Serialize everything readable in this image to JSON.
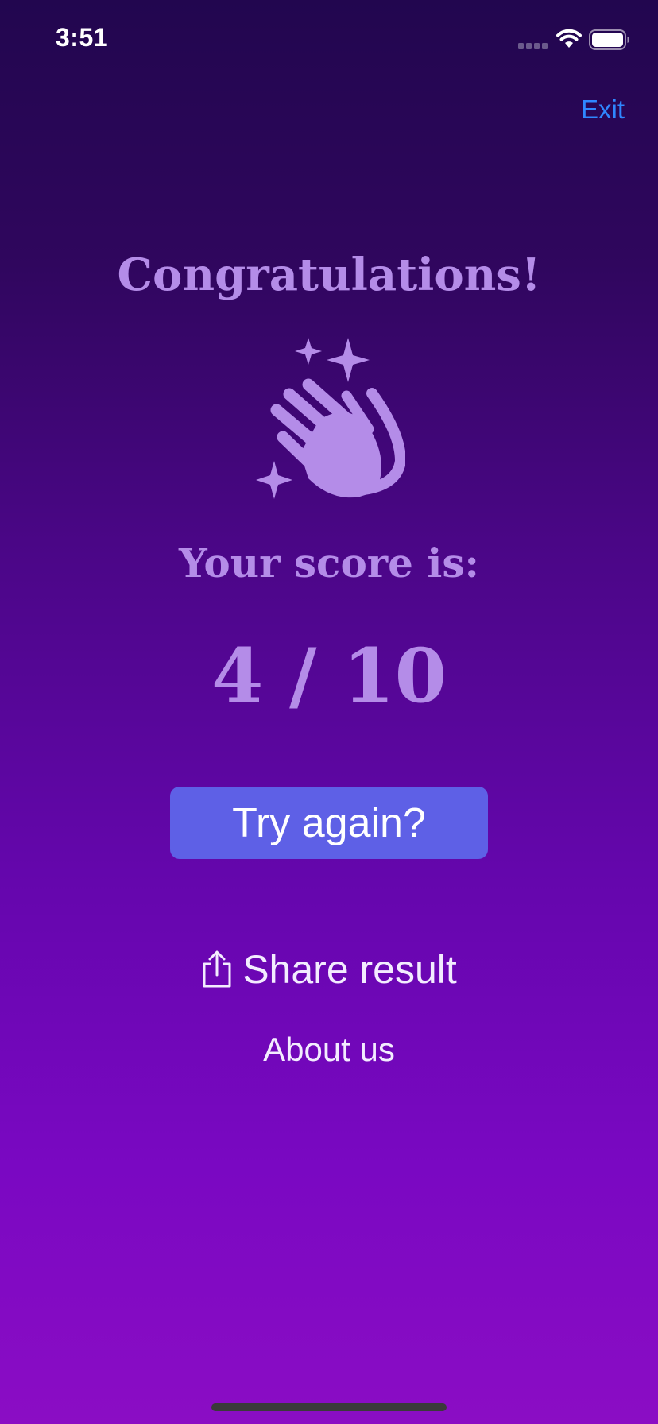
{
  "status_bar": {
    "time": "3:51",
    "icons": [
      "cellular-signal-icon",
      "wifi-icon",
      "battery-icon"
    ]
  },
  "nav": {
    "exit_label": "Exit"
  },
  "result": {
    "headline": "Congratulations!",
    "icon": "clapping-hands-icon",
    "score_label": "Your score is:",
    "score_value": "4 / 10"
  },
  "actions": {
    "try_again_label": "Try again?",
    "share_label": "Share result",
    "share_icon": "share-icon",
    "about_label": "About us"
  },
  "colors": {
    "accent_purple": "#b48ce8",
    "button_blue": "#5e60e6",
    "link_blue": "#2f87ff",
    "background_top": "#22064f",
    "background_bottom": "#8b0dc4"
  }
}
